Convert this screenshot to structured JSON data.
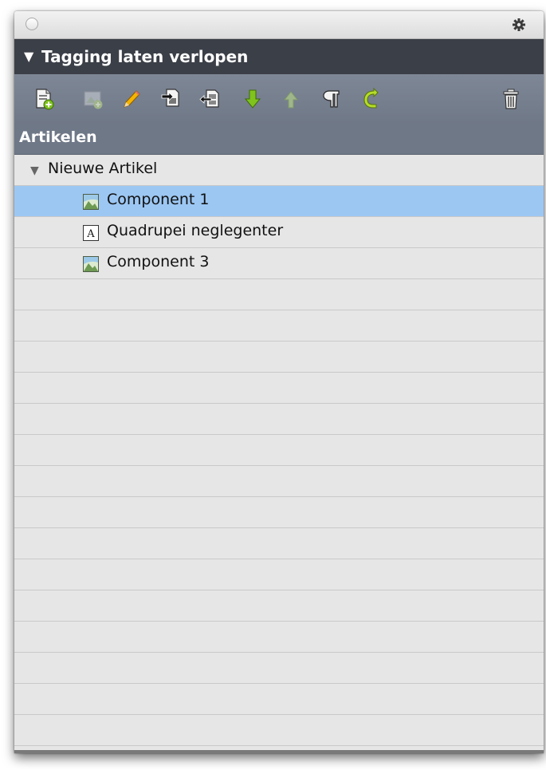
{
  "panel": {
    "section_title": "Tagging laten verlopen",
    "section_toggle": "▼",
    "list_header": "Artikelen"
  },
  "toolbar": {
    "icons": [
      "new-article-icon",
      "new-image-component-icon",
      "edit-pencil-icon",
      "import-component-icon",
      "export-component-icon",
      "move-down-arrow-icon",
      "move-up-arrow-icon",
      "paragraph-icon",
      "refresh-icon",
      "trash-icon"
    ]
  },
  "tree": {
    "parent": {
      "label": "Nieuwe Artikel",
      "toggle": "▼"
    },
    "children": [
      {
        "label": "Component 1",
        "icon": "image-component-icon",
        "selected": true
      },
      {
        "label": "Quadrupei neglegenter",
        "icon": "text-component-icon",
        "glyph": "A",
        "selected": false
      },
      {
        "label": "Component 3",
        "icon": "image-component-icon",
        "selected": false
      }
    ]
  },
  "colors": {
    "header_dark": "#3b3f47",
    "toolbar": "#737c8b",
    "selection": "#9cc7f3",
    "icon_green": "#7fc31c",
    "list_bg": "#e6e6e6"
  }
}
